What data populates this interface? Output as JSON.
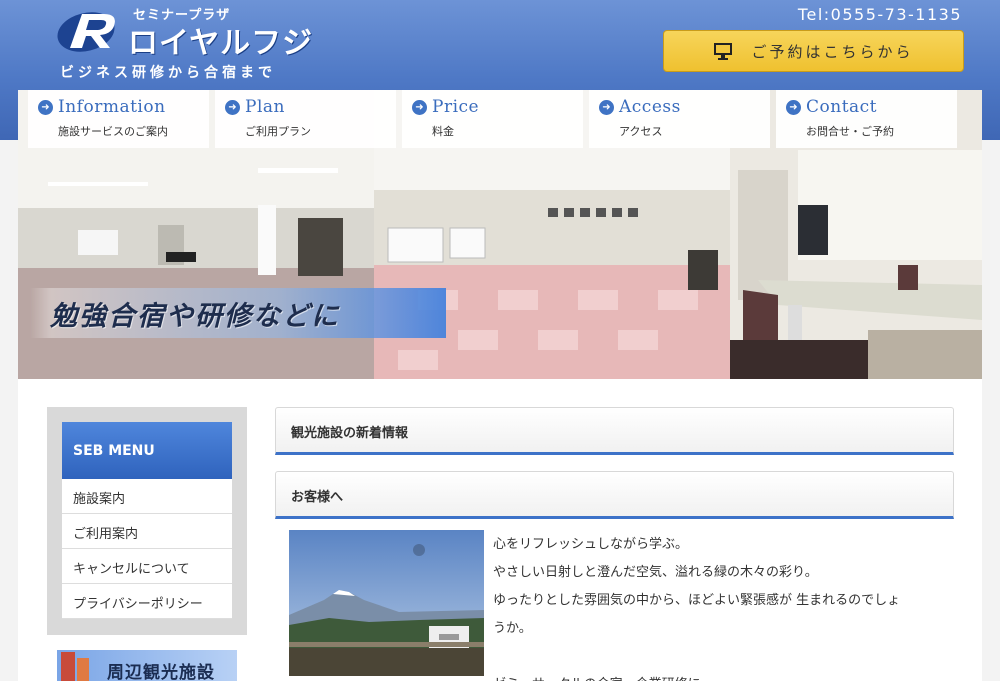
{
  "header": {
    "logo_sub": "セミナープラザ",
    "logo_main": "ロイヤルフジ",
    "tagline": "ビジネス研修から合宿まで",
    "tel": "Tel:0555-73-1135",
    "reserve_label": "ご予約はこちらから"
  },
  "nav": [
    {
      "en": "Information",
      "jp": "施設サービスのご案内"
    },
    {
      "en": "Plan",
      "jp": "ご利用プラン"
    },
    {
      "en": "Price",
      "jp": "料金"
    },
    {
      "en": "Access",
      "jp": "アクセス"
    },
    {
      "en": "Contact",
      "jp": "お問合せ・ご予約"
    }
  ],
  "hero": {
    "caption": "勉強合宿や研修などに"
  },
  "sidebar": {
    "title": "SEB MENU",
    "items": [
      {
        "label": "施設案内"
      },
      {
        "label": "ご利用案内"
      },
      {
        "label": "キャンセルについて"
      },
      {
        "label": "プライバシーポリシー"
      }
    ],
    "banner_label": "周辺観光施設"
  },
  "main": {
    "section1_title": "観光施設の新着情報",
    "section2_title": "お客様へ",
    "lines": [
      "心をリフレッシュしながら学ぶ。",
      "やさしい日射しと澄んだ空気、溢れる緑の木々の彩り。",
      "ゆったりとした雰囲気の中から、ほどよい緊張感が 生まれるのでしょ",
      "うか。",
      "",
      "ゼミ、サークルの合宿、企業研修に"
    ]
  },
  "colors": {
    "header_blue": "#4f79c6",
    "accent_blue": "#3d72c8",
    "button_yellow": "#f2c73e"
  }
}
